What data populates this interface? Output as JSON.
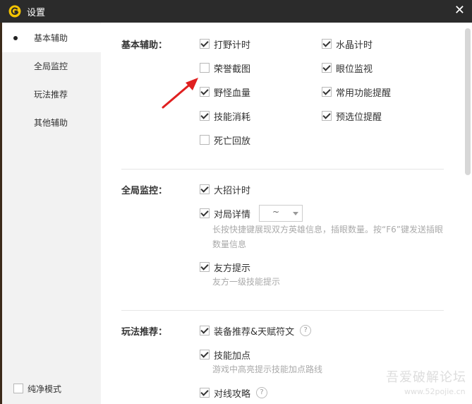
{
  "window": {
    "title": "设置"
  },
  "sidebar": {
    "items": [
      {
        "label": "基本辅助",
        "active": true
      },
      {
        "label": "全局监控",
        "active": false
      },
      {
        "label": "玩法推荐",
        "active": false
      },
      {
        "label": "其他辅助",
        "active": false
      }
    ],
    "pure_mode": {
      "label": "纯净模式",
      "checked": false
    }
  },
  "basic": {
    "title": "基本辅助：",
    "options": [
      {
        "label": "打野计时",
        "checked": true
      },
      {
        "label": "水晶计时",
        "checked": true
      },
      {
        "label": "荣誉截图",
        "checked": false
      },
      {
        "label": "眼位监视",
        "checked": true
      },
      {
        "label": "野怪血量",
        "checked": true
      },
      {
        "label": "常用功能提醒",
        "checked": true
      },
      {
        "label": "技能消耗",
        "checked": true
      },
      {
        "label": "预选位提醒",
        "checked": true
      },
      {
        "label": "死亡回放",
        "checked": false
      }
    ]
  },
  "monitor": {
    "title": "全局监控：",
    "ult_timer": {
      "label": "大招计时",
      "checked": true
    },
    "match_detail": {
      "label": "对局详情",
      "checked": true,
      "select_value": "~",
      "desc": "长按快捷键展现双方英雄信息，插眼数量。按“F6”键发送插眼数量信息"
    },
    "ally_tip": {
      "label": "友方提示",
      "checked": true,
      "desc": "友方一级技能提示"
    }
  },
  "recommend": {
    "title": "玩法推荐：",
    "items": [
      {
        "label": "装备推荐&天赋符文",
        "checked": true,
        "help": "?"
      },
      {
        "label": "技能加点",
        "checked": true,
        "desc": "游戏中高亮提示技能加点路线"
      },
      {
        "label": "对线攻略",
        "checked": true,
        "help": "?"
      }
    ]
  },
  "watermark": {
    "line1": "吾爱破解论坛",
    "line2": "www.52pojie.cn"
  }
}
